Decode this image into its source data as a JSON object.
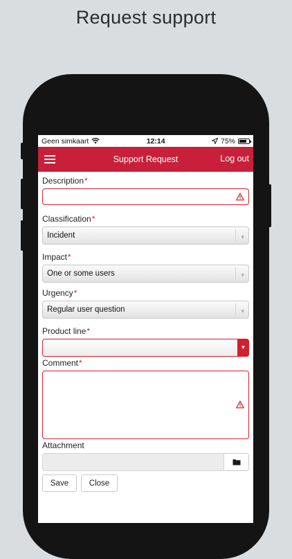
{
  "headline": "Request support",
  "status_bar": {
    "carrier": "Geen simkaart",
    "time": "12:14",
    "battery_percent": "75%",
    "battery_level": 0.75,
    "icons": [
      "wifi-icon",
      "location-arrow-icon",
      "battery-icon"
    ]
  },
  "navbar": {
    "menu_icon": "hamburger-icon",
    "title": "Support Request",
    "logout": "Log out",
    "color": "#c8203b"
  },
  "form": {
    "description": {
      "label": "Description",
      "required": "*",
      "value": ""
    },
    "classification": {
      "label": "Classification",
      "required": "*",
      "value": "Incident"
    },
    "impact": {
      "label": "Impact",
      "required": "*",
      "value": "One or some users"
    },
    "urgency": {
      "label": "Urgency",
      "required": "*",
      "value": "Regular user question"
    },
    "product_line": {
      "label": "Product line",
      "required": "*",
      "value": ""
    },
    "comment": {
      "label": "Comment",
      "required": "*",
      "value": ""
    },
    "attachment": {
      "label": "Attachment",
      "value": "",
      "icon": "folder-icon"
    }
  },
  "buttons": {
    "save": "Save",
    "close": "Close"
  },
  "colors": {
    "error": "#d0202e",
    "accent": "#c8203b"
  }
}
